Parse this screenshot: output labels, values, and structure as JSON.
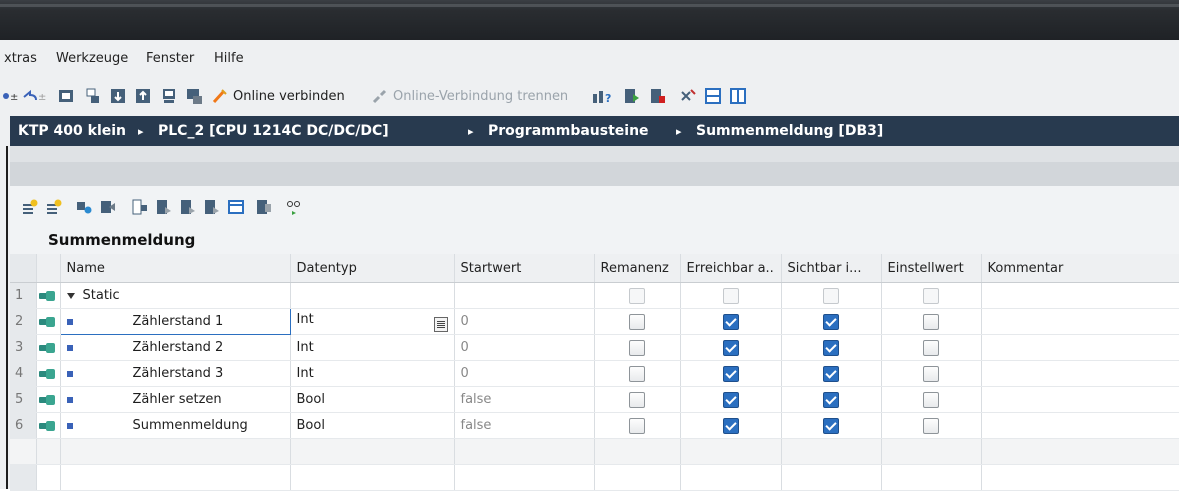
{
  "menu": [
    "xtras",
    "Werkzeuge",
    "Fenster",
    "Hilfe"
  ],
  "toolbar": {
    "online_connect": "Online verbinden",
    "online_disconnect": "Online-Verbindung trennen",
    "icons": [
      "arrow-icon",
      "undo-icon",
      "download-icon",
      "compile-icon",
      "upload-icon",
      "export-icon",
      "monitor-icon",
      "simulate-icon",
      "online-connect-icon",
      "online-disconnect-icon",
      "accessible-devices-icon",
      "start-cpu-icon",
      "stop-cpu-icon",
      "cross-reference-icon",
      "split-horizontal-icon",
      "split-vertical-icon"
    ]
  },
  "breadcrumb": {
    "items": [
      "KTP 400 klein",
      "PLC_2 [CPU 1214C DC/DC/DC]",
      "Programmbausteine",
      "Summenmeldung [DB3]"
    ],
    "separator": "▸"
  },
  "editor": {
    "block_name": "Summenmeldung",
    "columns": [
      "Name",
      "Datentyp",
      "Startwert",
      "Remanenz",
      "Erreichbar a..",
      "Sichtbar i...",
      "Einstellwert",
      "Kommentar"
    ],
    "rows": [
      {
        "num": "1",
        "name": "Static",
        "type": "",
        "start": "",
        "remanenz": false,
        "erreichbar": false,
        "sichtbar": false,
        "einstell": false,
        "group": true
      },
      {
        "num": "2",
        "name": "Zählerstand 1",
        "type": "Int",
        "start": "0",
        "remanenz": false,
        "erreichbar": true,
        "sichtbar": true,
        "einstell": false,
        "selected": true
      },
      {
        "num": "3",
        "name": "Zählerstand 2",
        "type": "Int",
        "start": "0",
        "remanenz": false,
        "erreichbar": true,
        "sichtbar": true,
        "einstell": false
      },
      {
        "num": "4",
        "name": "Zählerstand 3",
        "type": "Int",
        "start": "0",
        "remanenz": false,
        "erreichbar": true,
        "sichtbar": true,
        "einstell": false
      },
      {
        "num": "5",
        "name": "Zähler setzen",
        "type": "Bool",
        "start": "false",
        "remanenz": false,
        "erreichbar": true,
        "sichtbar": true,
        "einstell": false
      },
      {
        "num": "6",
        "name": "Summenmeldung",
        "type": "Bool",
        "start": "false",
        "remanenz": false,
        "erreichbar": true,
        "sichtbar": true,
        "einstell": false
      }
    ]
  },
  "colors": {
    "breadcrumb_bg": "#283a4f",
    "checkbox_checked": "#2b6fc0",
    "titlebar": "#2a2d31"
  }
}
